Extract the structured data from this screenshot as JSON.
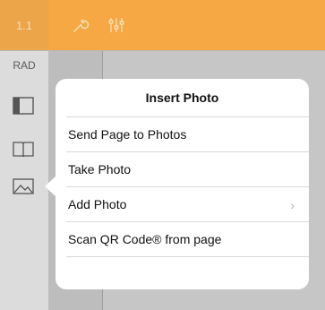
{
  "toolbar": {
    "tab_label": "1.1",
    "icons": [
      "wrench-icon",
      "sliders-icon"
    ],
    "accent_color": "#f5a844"
  },
  "sidebar": {
    "mode_label": "RAD",
    "icons": [
      "page-layout-icon",
      "book-icon",
      "photo-icon"
    ]
  },
  "popover": {
    "title": "Insert Photo",
    "items": [
      {
        "label": "Send Page to Photos"
      },
      {
        "label": "Take Photo"
      },
      {
        "label": "Add Photo",
        "has_submenu": true,
        "chevron": "›"
      },
      {
        "label": "Scan QR Code® from page"
      }
    ]
  }
}
